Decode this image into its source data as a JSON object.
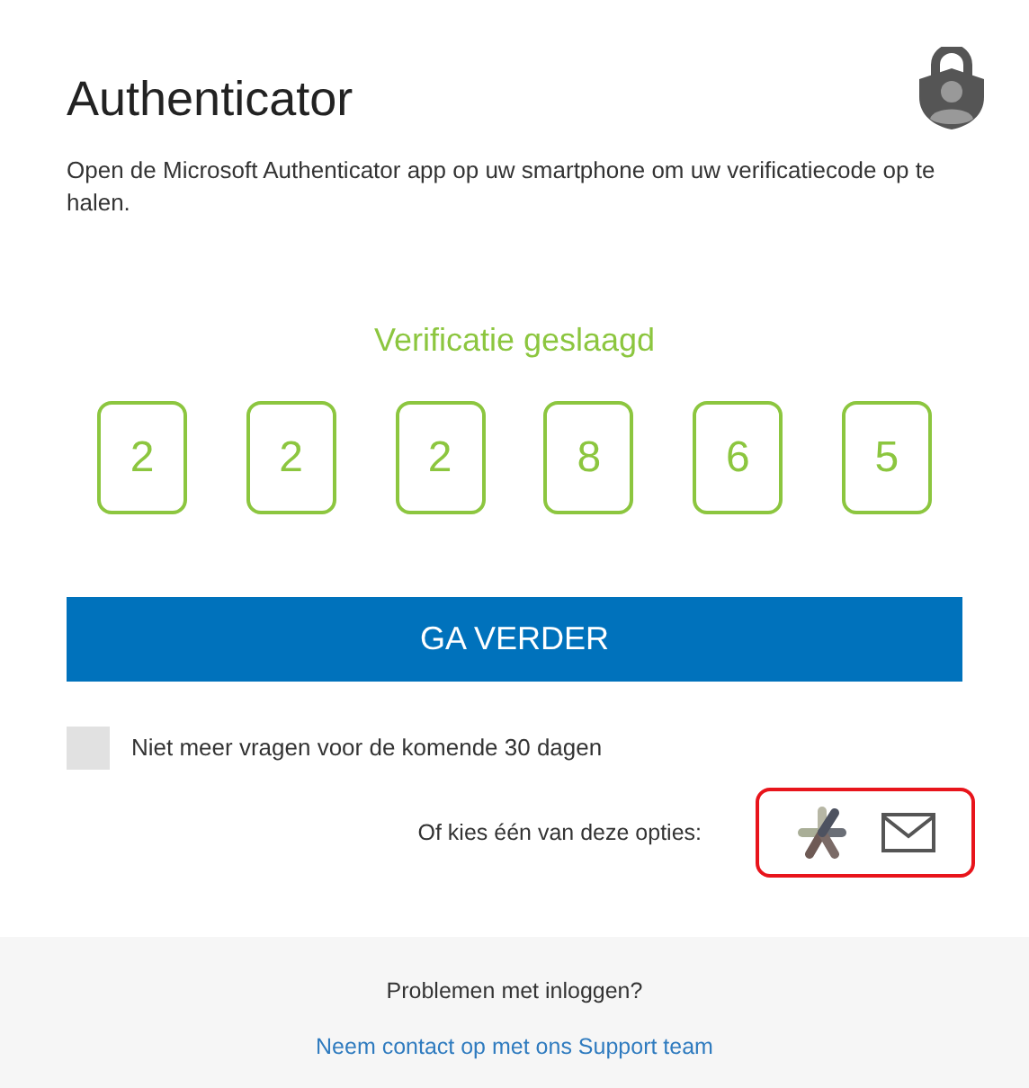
{
  "header": {
    "title": "Authenticator",
    "description": "Open de Microsoft Authenticator app op uw smartphone om uw verificatiecode op te halen."
  },
  "verification": {
    "status": "Verificatie geslaagd",
    "digits": [
      "2",
      "2",
      "2",
      "8",
      "6",
      "5"
    ]
  },
  "continue_button": "GA VERDER",
  "remember": {
    "label": "Niet meer vragen voor de komende 30 dagen",
    "checked": false
  },
  "options": {
    "label": "Of kies één van deze opties:",
    "highlighted": true
  },
  "footer": {
    "question": "Problemen met inloggen?",
    "link": "Neem contact op met ons Support team"
  }
}
